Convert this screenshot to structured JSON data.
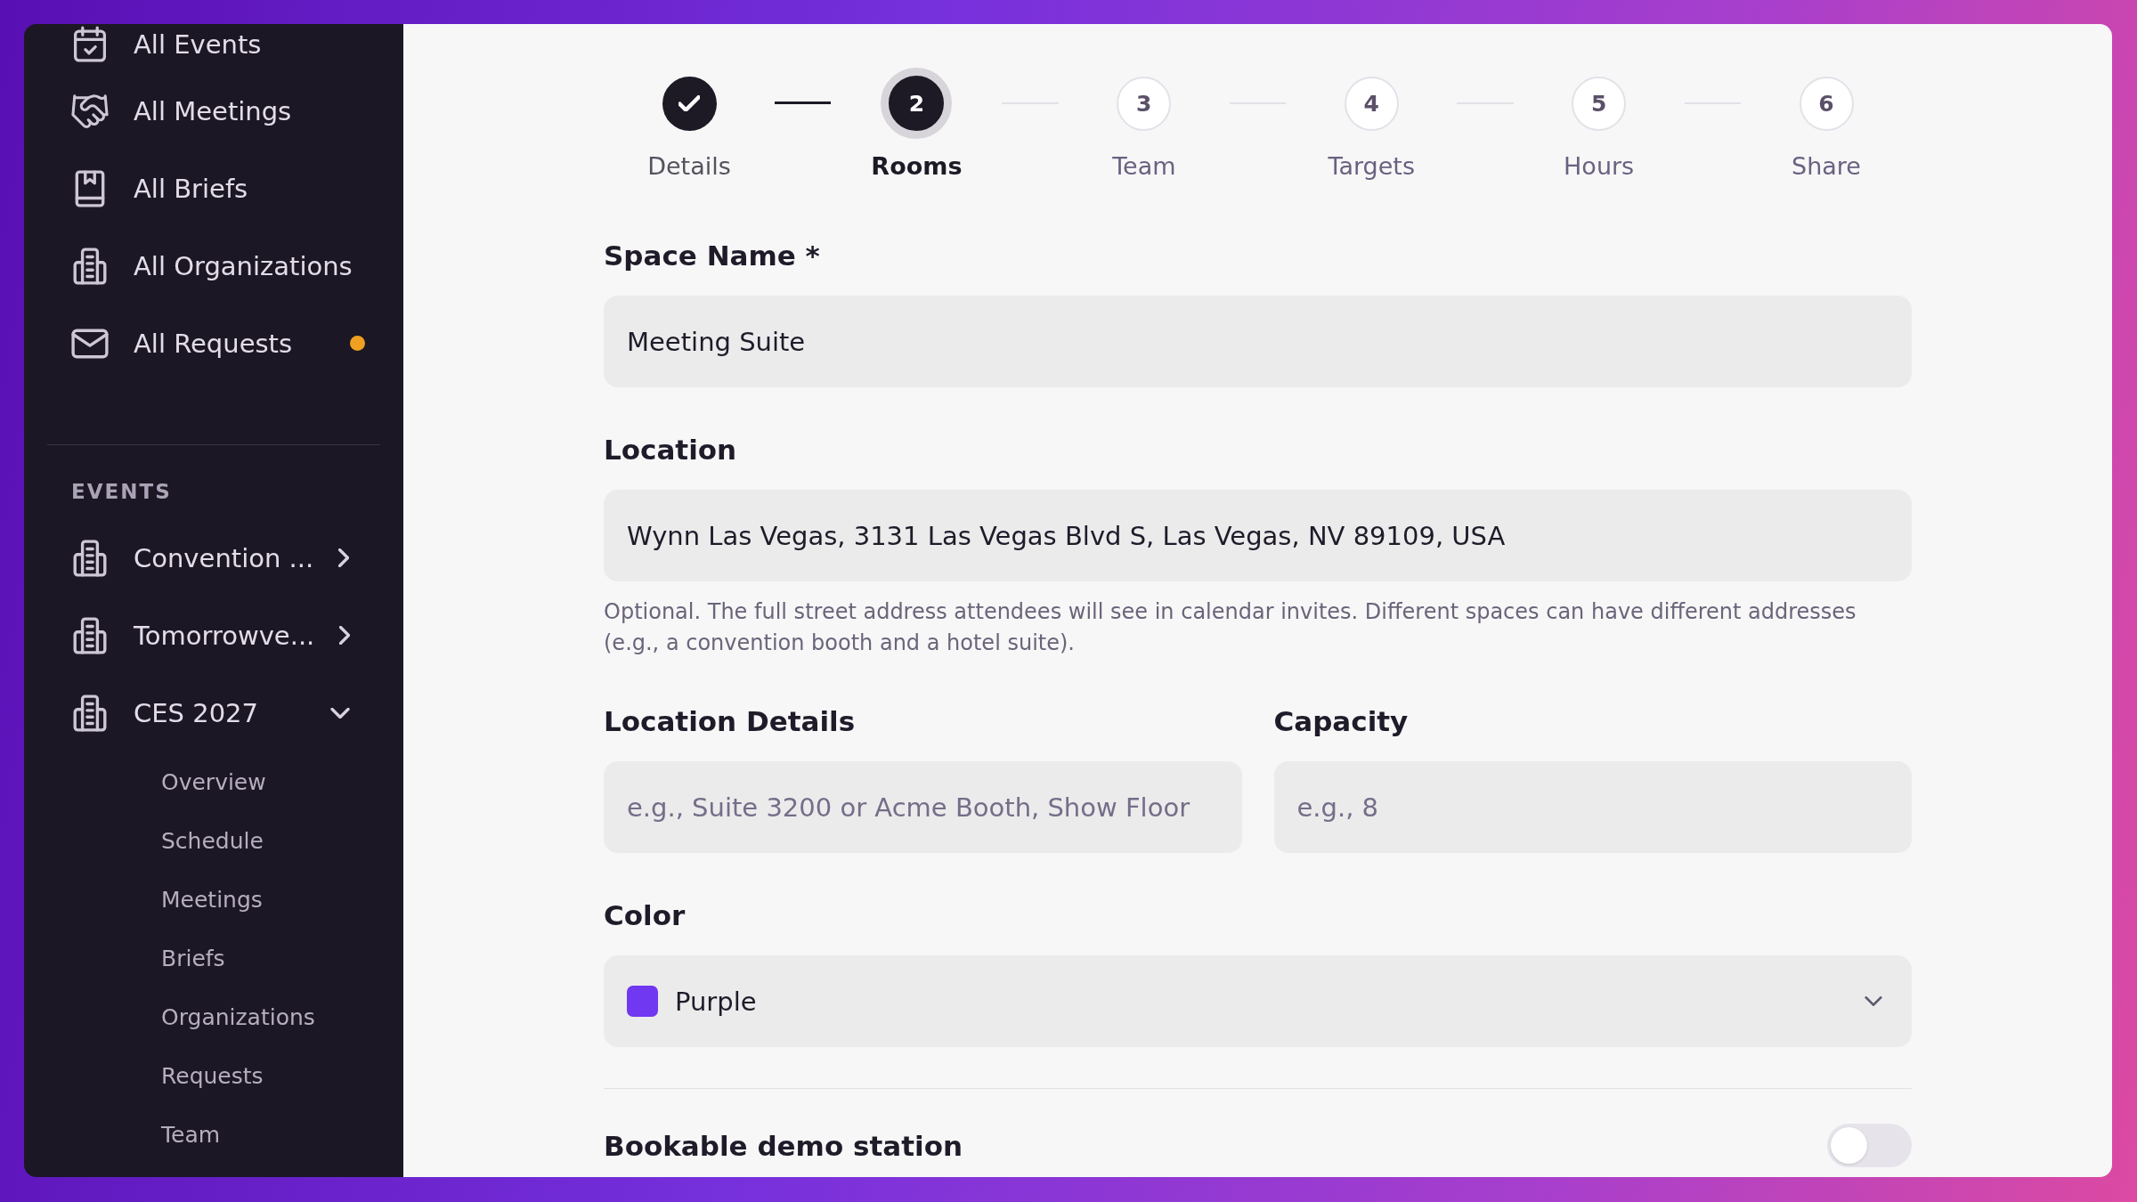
{
  "sidebar": {
    "nav_items": [
      {
        "label": "All Events",
        "selected": false,
        "unread": false
      },
      {
        "label": "All Meetings",
        "selected": false,
        "unread": false
      },
      {
        "label": "All Briefs",
        "selected": false,
        "unread": false
      },
      {
        "label": "All Organizations",
        "selected": false,
        "unread": false
      },
      {
        "label": "All Requests",
        "selected": false,
        "unread": true
      }
    ],
    "section_title": "EVENTS",
    "events": [
      {
        "label": "Convention ...",
        "expanded": false
      },
      {
        "label": "Tomorrowve...",
        "expanded": false
      },
      {
        "label": "CES 2027",
        "expanded": true,
        "children": [
          {
            "label": "Overview",
            "selected": false
          },
          {
            "label": "Schedule",
            "selected": false
          },
          {
            "label": "Meetings",
            "selected": false
          },
          {
            "label": "Briefs",
            "selected": false
          },
          {
            "label": "Organizations",
            "selected": false
          },
          {
            "label": "Requests",
            "selected": false
          },
          {
            "label": "Team",
            "selected": false
          }
        ]
      }
    ]
  },
  "stepper": {
    "steps": [
      {
        "label": "Details",
        "completed": true,
        "selected": false
      },
      {
        "number": "2",
        "label": "Rooms",
        "completed": false,
        "selected": true
      },
      {
        "number": "3",
        "label": "Team",
        "completed": false,
        "selected": false
      },
      {
        "number": "4",
        "label": "Targets",
        "completed": false,
        "selected": false
      },
      {
        "number": "5",
        "label": "Hours",
        "completed": false,
        "selected": false
      },
      {
        "number": "6",
        "label": "Share",
        "completed": false,
        "selected": false
      }
    ]
  },
  "form": {
    "space_name": {
      "label": "Space Name *",
      "value": "Meeting Suite"
    },
    "location": {
      "label": "Location",
      "value": "Wynn Las Vegas, 3131 Las Vegas Blvd S, Las Vegas, NV 89109, USA",
      "help": "Optional. The full street address attendees will see in calendar invites. Different spaces can have different addresses (e.g., a convention booth and a hotel suite)."
    },
    "location_details": {
      "label": "Location Details",
      "placeholder": "e.g., Suite 3200 or Acme Booth, Show Floor"
    },
    "capacity": {
      "label": "Capacity",
      "placeholder": "e.g., 8"
    },
    "color": {
      "label": "Color",
      "value": "Purple",
      "color": "#7038f0"
    },
    "bookable_demo_station": {
      "label": "Bookable demo station",
      "on": false
    }
  }
}
